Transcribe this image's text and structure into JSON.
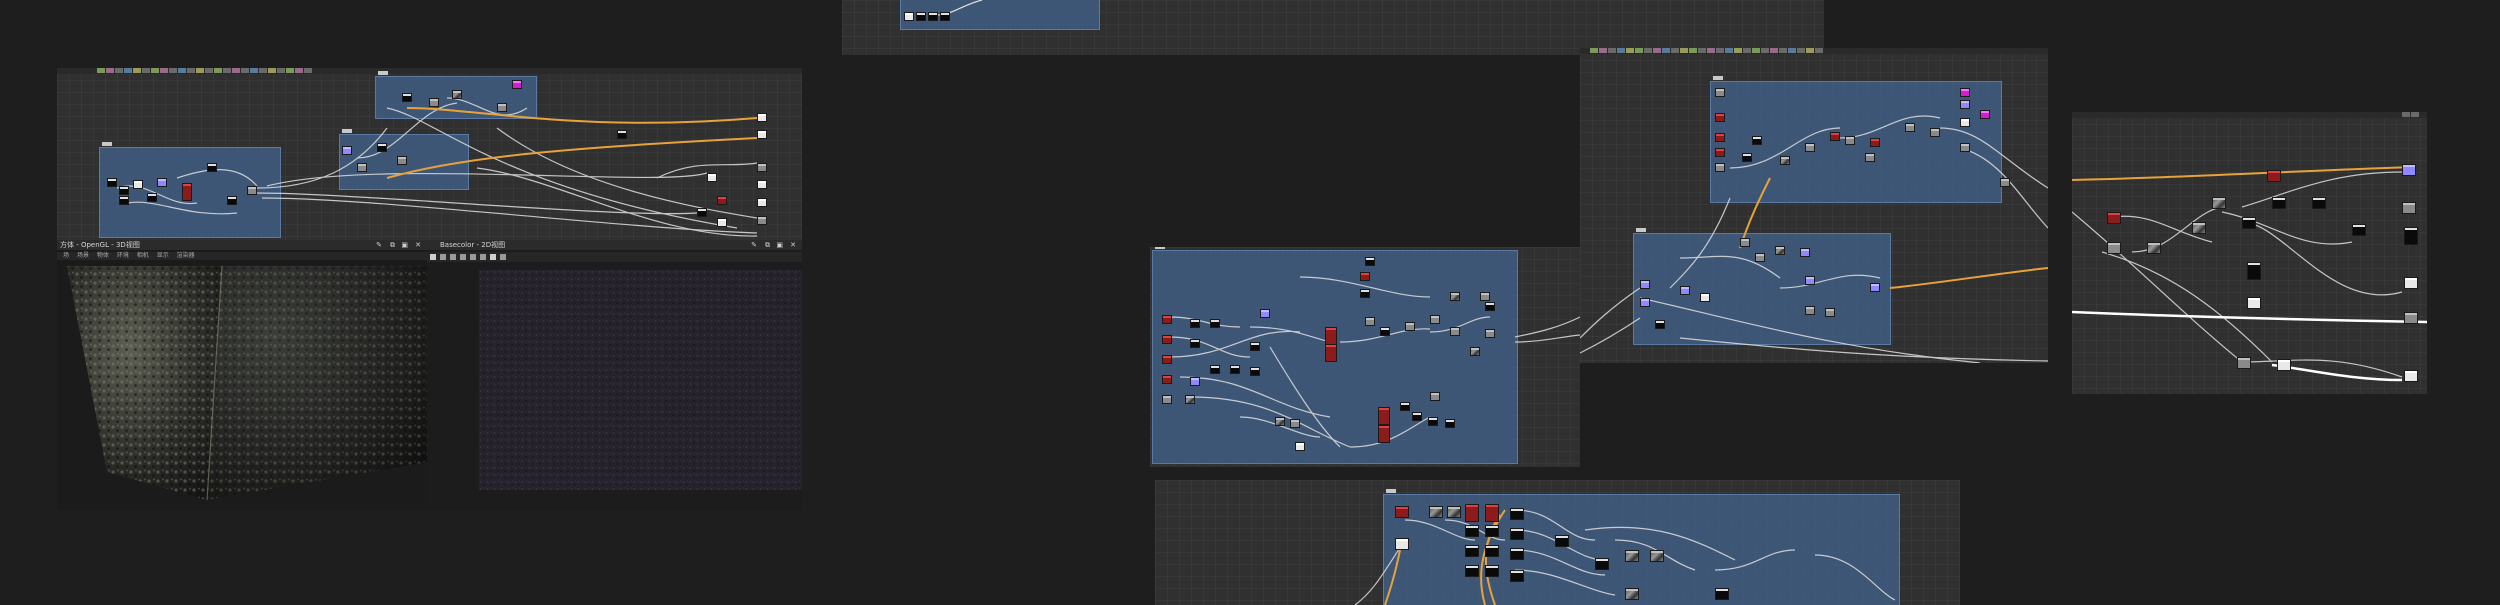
{
  "panel_3d": {
    "title": "方体 - OpenGL - 3D视图",
    "menu": [
      "场",
      "场景",
      "物体",
      "环境",
      "相机",
      "显示",
      "渲染器"
    ]
  },
  "panel_2d": {
    "title": "Basecolor - 2D视图"
  },
  "panel_controls": {
    "pin": "✎",
    "float": "⧉",
    "maximize": "▣",
    "close": "✕"
  },
  "colors": {
    "background": "#1e1e1e",
    "graph": "#303030",
    "frame": "#42628a",
    "wire_orange": "#e8a23a",
    "wire_white": "#e0e0e0"
  }
}
